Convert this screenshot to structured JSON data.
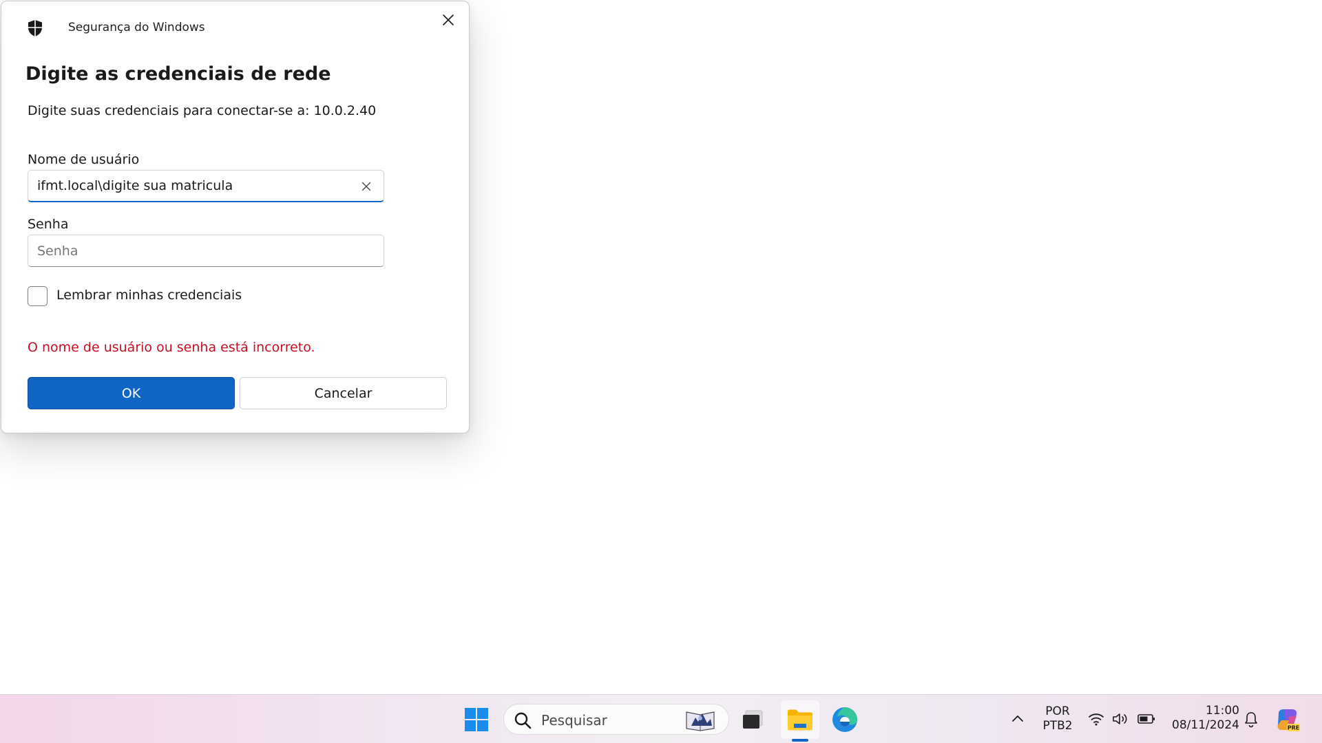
{
  "dialog": {
    "window_title": "Segurança do Windows",
    "heading": "Digite as credenciais de rede",
    "subtitle": "Digite suas credenciais para conectar-se a: 10.0.2.40",
    "username": {
      "label": "Nome de usuário",
      "value": "ifmt.local\\digite sua matricula"
    },
    "password": {
      "label": "Senha",
      "placeholder": "Senha"
    },
    "remember": {
      "label": "Lembrar minhas credenciais",
      "checked": false
    },
    "error_message": "O nome de usuário ou senha está incorreto.",
    "ok_label": "OK",
    "cancel_label": "Cancelar"
  },
  "taskbar": {
    "search_placeholder": "Pesquisar",
    "language_line1": "POR",
    "language_line2": "PTB2",
    "time": "11:00",
    "date": "08/11/2024",
    "copilot_badge": "PRE"
  },
  "colors": {
    "accent": "#0f64c4",
    "error": "#c50f1f"
  }
}
